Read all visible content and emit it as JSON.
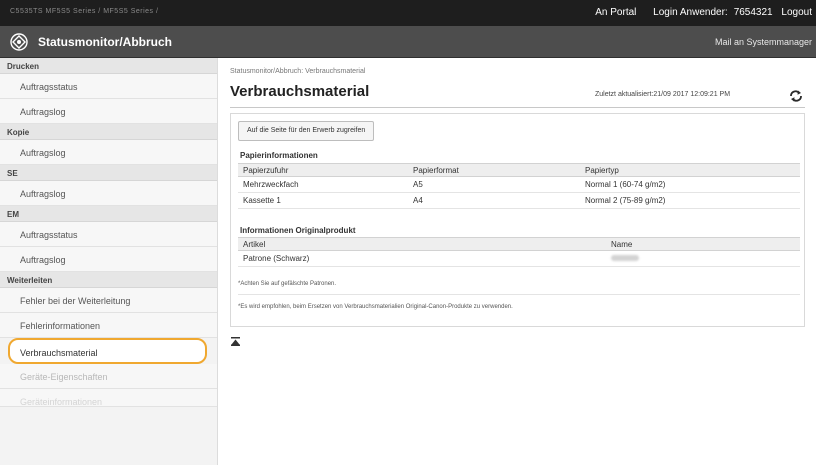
{
  "topbar": {
    "device": "C5535TS  MF5S5 Series / MF5S5 Series /",
    "portal": "An Portal",
    "login_label": "Login Anwender:",
    "login_user": "7654321",
    "logout": "Logout"
  },
  "titlebar": {
    "title": "Statusmonitor/Abbruch",
    "mail": "Mail an Systemmanager"
  },
  "sidebar": {
    "groups": [
      {
        "header": "Drucken",
        "items": [
          "Auftragsstatus",
          "Auftragslog"
        ]
      },
      {
        "header": "Kopie",
        "items": [
          "Auftragslog"
        ]
      },
      {
        "header": "SE",
        "items": [
          "Auftragslog"
        ]
      },
      {
        "header": "EM",
        "items": [
          "Auftragsstatus",
          "Auftragslog"
        ]
      },
      {
        "header": "Weiterleiten",
        "items": [
          "Fehler bei der Weiterleitung",
          "Fehlerinformationen",
          "Verbrauchsmaterial",
          "Geräte-Eigenschaften",
          "Geräteinformationen"
        ]
      }
    ]
  },
  "main": {
    "breadcrumb": "Statusmonitor/Abbruch: Verbrauchsmaterial",
    "title": "Verbrauchsmaterial",
    "updated": "Zuletzt aktualisiert:21/09 2017 12:09:21 PM",
    "purchase_button": "Auf die Seite für den Erwerb zugreifen",
    "paper": {
      "title": "Papierinformationen",
      "headers": [
        "Papierzufuhr",
        "Papierformat",
        "Papiertyp"
      ],
      "rows": [
        [
          "Mehrzweckfach",
          "A5",
          "Normal 1 (60-74 g/m2)"
        ],
        [
          "Kassette 1",
          "A4",
          "Normal 2 (75-89 g/m2)"
        ]
      ]
    },
    "original": {
      "title": "Informationen Originalprodukt",
      "headers": [
        "Artikel",
        "Name"
      ],
      "rows": [
        [
          "Patrone (Schwarz)",
          ""
        ]
      ]
    },
    "note1": "*Achten Sie auf gefälschte Patronen.",
    "note2": "*Es wird empfohlen, beim Ersetzen von Verbrauchsmaterialien Original-Canon-Produkte zu verwenden."
  },
  "colors": {
    "topbar_bg": "#1e1e1e",
    "titlebar_bg": "#4d4d4d",
    "selection_outline": "#f0a830"
  },
  "icons": [
    "logo-icon",
    "refresh-icon",
    "scroll-top-icon"
  ]
}
